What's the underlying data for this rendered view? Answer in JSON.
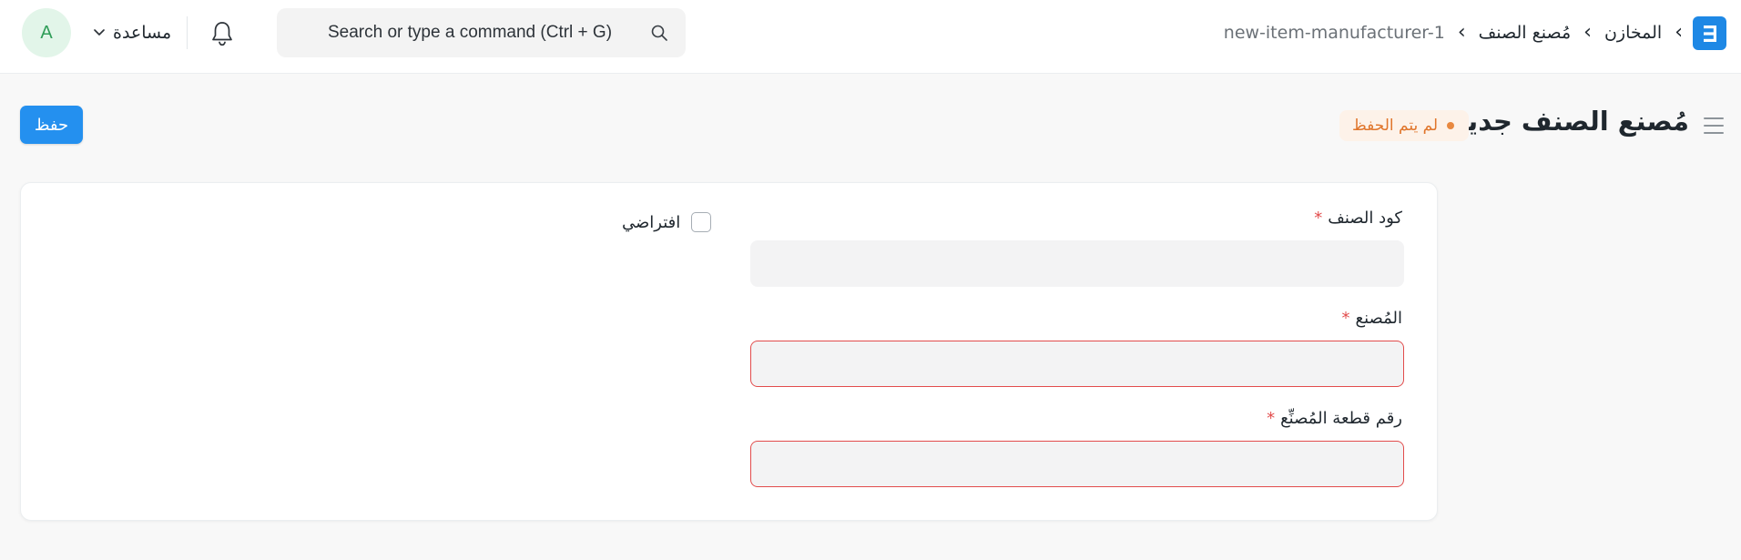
{
  "navbar": {
    "logo_letter": "E",
    "breadcrumbs": [
      {
        "label": "المخازن"
      },
      {
        "label": "مُصنع الصنف"
      },
      {
        "label": "new-item-manufacturer-1"
      }
    ],
    "search": {
      "placeholder": "Search or type a command (Ctrl + G)",
      "value": ""
    },
    "notifications_icon": "bell-icon",
    "help_label": "مساعدة",
    "avatar_initial": "A"
  },
  "page_head": {
    "title": "مُصنع الصنف جديد",
    "status": "لم يتم الحفظ",
    "save_label": "حفظ"
  },
  "form": {
    "fields": [
      {
        "label": "كود الصنف",
        "required": true,
        "value": "",
        "error": false
      },
      {
        "label": "المُصنع",
        "required": true,
        "value": "",
        "error": true
      },
      {
        "label": "رقم قطعة المُصنِّع",
        "required": true,
        "value": "",
        "error": true
      }
    ],
    "default_checkbox": {
      "label": "افتراضي",
      "checked": false
    }
  },
  "colors": {
    "primary": "#2490ef",
    "logo": "#1e88e5",
    "status_text": "#e0752b",
    "status_bg": "#fdf2e9",
    "required": "#e24c4c",
    "avatar_bg": "#e2f5e9",
    "avatar_fg": "#2f9d58"
  }
}
